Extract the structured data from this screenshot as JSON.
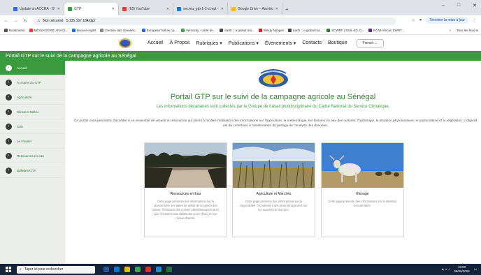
{
  "browser": {
    "tabs": [
      {
        "title": "Update on ACCRA - GTP Mali",
        "color": "#2d6cdf",
        "active": false
      },
      {
        "title": "GTP",
        "color": "#3a9a3d",
        "active": true
      },
      {
        "title": "(65) YouTube",
        "color": "#e53935",
        "active": false
      },
      {
        "title": "secrea_gtp-1-2-st.ept - Google",
        "color": "#1a73e8",
        "active": false
      },
      {
        "title": "Google Drive – Avertissement",
        "color": "#fbbc04",
        "active": false
      }
    ],
    "new_tab": "+",
    "window_controls": [
      "–",
      "□",
      "✕"
    ],
    "address": {
      "warning": "Non sécurisé",
      "url": "5.135.167.184/gtp/"
    },
    "update_button": "Terminer la mise à jour",
    "bookmarks": [
      {
        "label": "Bookmarks",
        "color": "#555555"
      },
      {
        "label": "MESSAGERIE ANACI...",
        "color": "#e53935"
      },
      {
        "label": "Nouvel onglet",
        "color": "#1a73e8"
      },
      {
        "label": "Gestion des données...",
        "color": "#888888"
      },
      {
        "label": "European hollow ca...",
        "color": "#2d6cdf"
      },
      {
        "label": "Vernacky - carte de...",
        "color": "#43a047"
      },
      {
        "label": "earth :: a global ma...",
        "color": "#444444"
      },
      {
        "label": "Windy Nuages",
        "color": "#c62828"
      },
      {
        "label": "earth :: a global ma...",
        "color": "#444444"
      },
      {
        "label": "SCWRF | ENIL-4D, D...",
        "color": "#2e7d32"
      },
      {
        "label": "ECMI African SWRT...",
        "color": "#6a1b9a"
      }
    ],
    "bookmarks_more": "»",
    "all_bookmarks": "Tous les favoris"
  },
  "site": {
    "nav": [
      "Accueil",
      "À Propos",
      "Rubriques ▾",
      "Publications ▾",
      "Évenements ▾",
      "Contacts",
      "Boutique"
    ],
    "language": "French ⌄",
    "banner": "Portail GTP sur le suivi de la campagne agricole au Sénégal",
    "sidebar": [
      {
        "label": "Accueil",
        "active": true
      },
      {
        "label": "À propos du GTP",
        "active": false
      },
      {
        "label": "Agriculture",
        "active": false
      },
      {
        "label": "Climat et Météo",
        "active": false
      },
      {
        "label": "Sols",
        "active": false
      },
      {
        "label": "Le cheptel",
        "active": false
      },
      {
        "label": "Ressources en eau",
        "active": false
      },
      {
        "label": "Bulletins GTP",
        "active": false
      }
    ],
    "emblem_text": "ANACIM",
    "title": "Portail GTP sur le suivi de la campagne agricole au Sénégal",
    "subtitle": "Les informations décadaires sont collectés par le Groupe de travail pluridisciplinaire du Cadre National du Service Climatique.",
    "description": "Ce portail vous permettra d'accéder à un ensemble de visuels et ressources qui visent à faciliter l'utilisation des informations sur l'agriculture, la météorologie, les besoins en eau des cultures, l'hydrologie, la situation phytosanitaire, le pastoralisme et la végétation. L'objectif est de contribuer à l'amélioration du partage de l'analyse des données.",
    "cards": [
      {
        "title": "Ressources en Eau",
        "text": "Cette page présente des informations sur la pluviométrie, les dates de début de la saison des pluies, l'évolution des cumuls pluviométriques ainsi que l'évolution des débits des cours d'eau et leur niveau d'alerte."
      },
      {
        "title": "Agriculture et Marchés",
        "text": "Cette page présente des informations sur la disponibilité, l'écoulement des produits agricoles sur les marchés et leur prix."
      },
      {
        "title": "Élevage",
        "text": "Cette page présente des informations sur la situation zoo sanitaire."
      }
    ]
  },
  "taskbar": {
    "search_placeholder": "Taper ici pour rechercher",
    "time": "13:00",
    "date": "06/09/2024"
  }
}
